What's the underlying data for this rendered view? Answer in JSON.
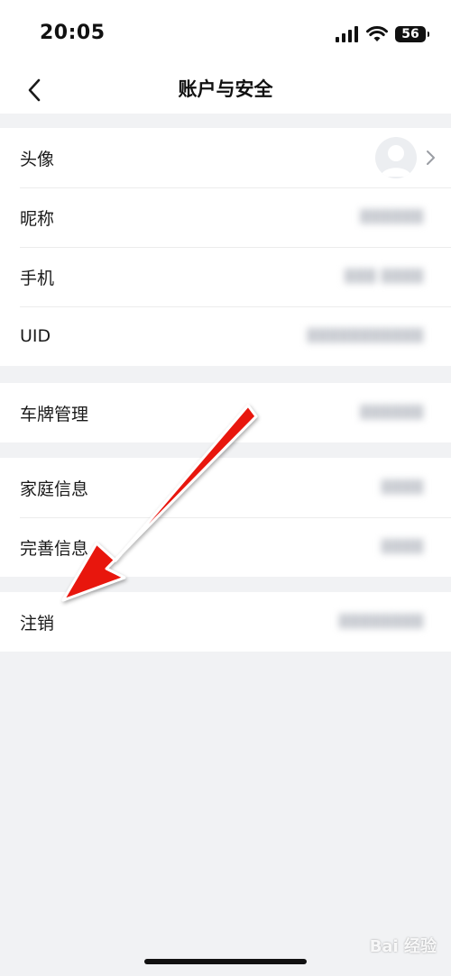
{
  "status_bar": {
    "time": "20:05",
    "battery_level": "56",
    "signal_icon": "cellular-signal-icon",
    "wifi_icon": "wifi-icon"
  },
  "nav": {
    "title": "账户与安全",
    "back_icon": "chevron-left-icon"
  },
  "groups": [
    {
      "rows": [
        {
          "label": "头像",
          "type": "avatar"
        },
        {
          "label": "昵称",
          "value": "██████"
        },
        {
          "label": "手机",
          "value": "███ ████"
        },
        {
          "label": "UID",
          "value": "███████████"
        }
      ]
    },
    {
      "rows": [
        {
          "label": "车牌管理",
          "value": "██████"
        }
      ]
    },
    {
      "rows": [
        {
          "label": "家庭信息",
          "value": "████"
        },
        {
          "label": "完善信息",
          "value": "████"
        }
      ]
    },
    {
      "rows": [
        {
          "label": "注销",
          "value": "████████"
        }
      ]
    }
  ],
  "annotation": {
    "arrow_color": "#e8140e",
    "arrow_icon": "red-arrow-annotation"
  },
  "watermark": {
    "text": "Bai 经验"
  },
  "colors": {
    "background": "#f1f2f4",
    "surface": "#ffffff",
    "text_primary": "#1a1a1a",
    "divider": "#ececec"
  }
}
